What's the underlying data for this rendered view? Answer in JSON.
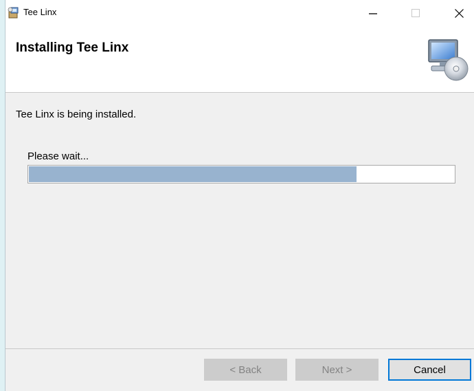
{
  "window": {
    "title": "Tee Linx",
    "controls": {
      "minimize": "—",
      "maximize": "☐",
      "close": "✕"
    },
    "app_icon": "installer-package-icon"
  },
  "header": {
    "title": "Installing Tee Linx",
    "icon": "computer-cd-icon"
  },
  "body": {
    "status": "Tee Linx is being installed.",
    "wait_label": "Please wait...",
    "progress_fraction": 0.77
  },
  "footer": {
    "back_label": "< Back",
    "next_label": "Next >",
    "cancel_label": "Cancel"
  },
  "colors": {
    "progress_fill": "#98b3cf",
    "focus_border": "#0078d7"
  }
}
